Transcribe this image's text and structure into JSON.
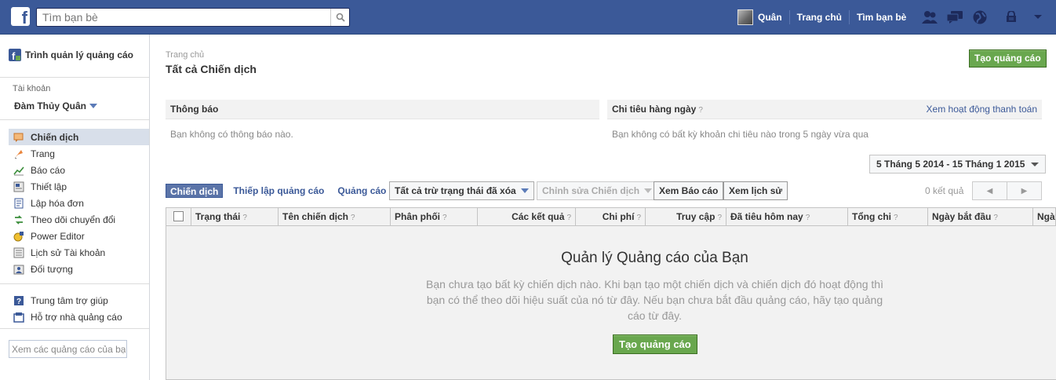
{
  "topbar": {
    "search_placeholder": "Tìm bạn bè",
    "user_name": "Quân",
    "home_link": "Trang chủ",
    "find_friends_link": "Tìm bạn bè",
    "brand_color": "#3b5998"
  },
  "sidebar": {
    "title": "Trình quản lý quảng cáo",
    "account_label": "Tài khoản",
    "account_name": "Đàm Thủy Quân",
    "items": [
      {
        "label": "Chiến dịch",
        "icon": "campaign-icon",
        "active": true
      },
      {
        "label": "Trang",
        "icon": "flag-icon"
      },
      {
        "label": "Báo cáo",
        "icon": "chart-icon"
      },
      {
        "label": "Thiết lập",
        "icon": "settings-icon"
      },
      {
        "label": "Lập hóa đơn",
        "icon": "billing-icon"
      },
      {
        "label": "Theo dõi chuyển đổi",
        "icon": "conversion-icon"
      },
      {
        "label": "Power Editor",
        "icon": "power-editor-icon"
      },
      {
        "label": "Lịch sử Tài khoản",
        "icon": "history-icon"
      },
      {
        "label": "Đối tượng",
        "icon": "audience-icon"
      }
    ],
    "help_items": [
      {
        "label": "Trung tâm trợ giúp",
        "icon": "help-icon"
      },
      {
        "label": "Hỗ trợ nhà quảng cáo",
        "icon": "support-icon"
      }
    ],
    "search_placeholder": "Xem các quảng cáo của bạn"
  },
  "main": {
    "breadcrumb": "Trang chủ",
    "title": "Tất cả Chiến dịch",
    "create_ad": "Tạo quảng cáo",
    "notifications": {
      "title": "Thông báo",
      "empty": "Bạn không có thông báo nào."
    },
    "daily_spend": {
      "title": "Chi tiêu hàng ngày",
      "help": "?",
      "link": "Xem hoạt động thanh toán",
      "empty": "Bạn không có bất kỳ khoản chi tiêu nào trong 5 ngày vừa qua"
    },
    "date_range": "5 Tháng 5 2014 - 15 Tháng 1 2015",
    "tabs": [
      "Chiến dịch",
      "Thiếp lập quảng cáo",
      "Quảng cáo"
    ],
    "status_filter": "Tất cả trừ trạng thái đã xóa",
    "edit_campaign": "Chỉnh sửa Chiến dịch",
    "view_report": "Xem Báo cáo",
    "view_history": "Xem lịch sử",
    "results_count": "0 kết quả",
    "columns": [
      "Trạng thái",
      "Tên chiến dịch",
      "Phân phối",
      "Các kết quả",
      "Chi phí",
      "Truy cập",
      "Đã tiêu hôm nay",
      "Tổng chi",
      "Ngày bắt đầu",
      "Ngày"
    ],
    "empty_state": {
      "title": "Quản lý Quảng cáo của Bạn",
      "description": "Bạn chưa tạo bất kỳ chiến dịch nào. Khi bạn tạo một chiến dịch và chiến dịch đó hoạt động thì bạn có thể theo dõi hiệu suất của nó từ đây. Nếu bạn chưa bắt đầu quảng cáo, hãy tạo quảng cáo từ đây.",
      "button": "Tạo quảng cáo"
    }
  }
}
